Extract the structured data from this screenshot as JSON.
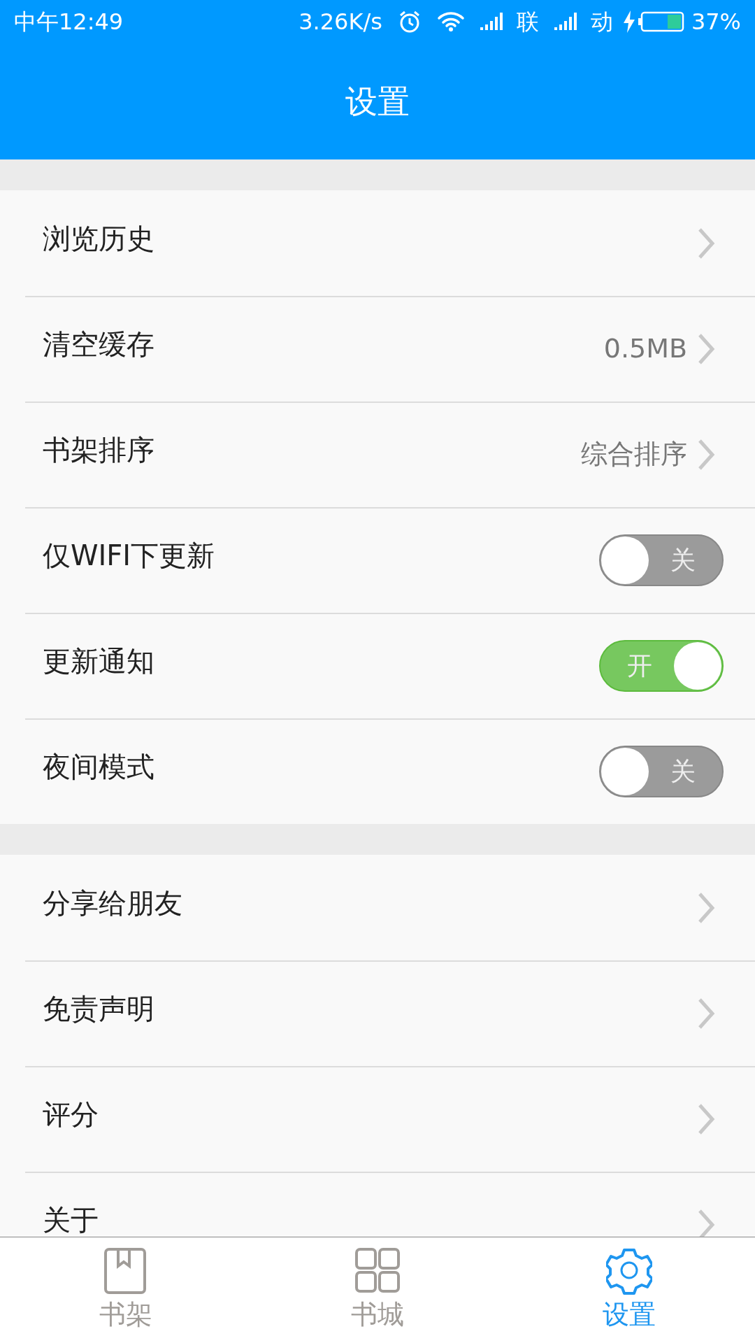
{
  "status_bar": {
    "time": "中午12:49",
    "network_speed": "3.26K/s",
    "sim_1": "联",
    "sim_2": "动",
    "battery": "37%"
  },
  "header": {
    "title": "设置"
  },
  "groups": [
    {
      "items": [
        {
          "kind": "link",
          "label": "浏览历史"
        },
        {
          "kind": "link",
          "label": "清空缓存",
          "value": "0.5MB"
        },
        {
          "kind": "link",
          "label": "书架排序",
          "value": "综合排序"
        },
        {
          "kind": "toggle",
          "label": "仅WIFI下更新",
          "on": false,
          "toggle_text": "关"
        },
        {
          "kind": "toggle",
          "label": "更新通知",
          "on": true,
          "toggle_text": "开"
        },
        {
          "kind": "toggle",
          "label": "夜间模式",
          "on": false,
          "toggle_text": "关"
        }
      ]
    },
    {
      "items": [
        {
          "kind": "link",
          "label": "分享给朋友"
        },
        {
          "kind": "link",
          "label": "免责声明"
        },
        {
          "kind": "link",
          "label": "评分"
        },
        {
          "kind": "link",
          "label": "关于"
        }
      ]
    }
  ],
  "tabs": [
    {
      "kind": "bookshelf",
      "label": "书架",
      "selected": false
    },
    {
      "kind": "store",
      "label": "书城",
      "selected": false
    },
    {
      "kind": "settings",
      "label": "设置",
      "selected": true
    }
  ]
}
